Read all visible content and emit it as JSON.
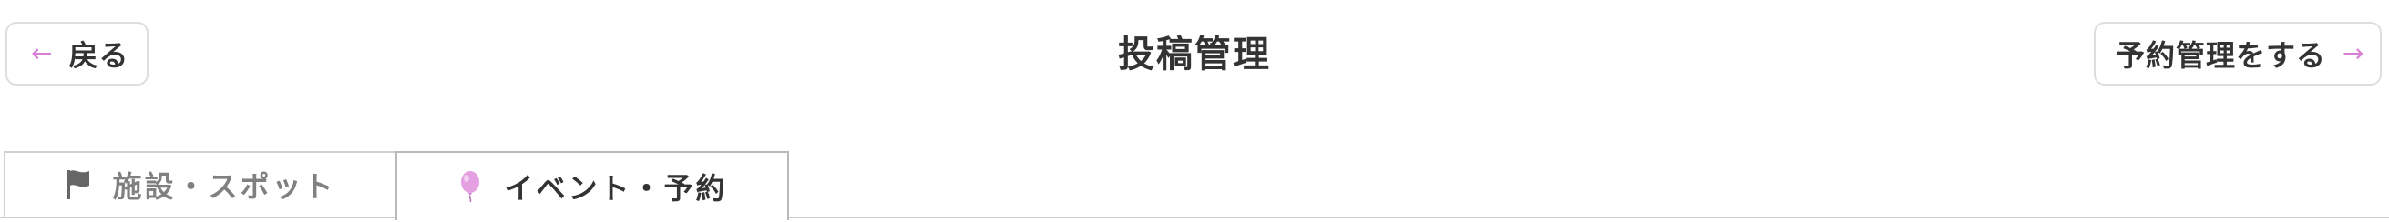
{
  "header": {
    "title": "投稿管理",
    "back_button": {
      "label": "戻る",
      "icon": "arrow-left-icon"
    },
    "next_button": {
      "label": "予約管理をする",
      "icon": "arrow-right-icon"
    }
  },
  "tabs": [
    {
      "label": "施設・スポット",
      "icon": "flag-icon",
      "active": false
    },
    {
      "label": "イベント・予約",
      "icon": "balloon-icon",
      "active": true
    }
  ],
  "colors": {
    "accent": "#d77fd4",
    "text": "#333333",
    "inactive_text": "#808080",
    "border": "#dedede"
  }
}
